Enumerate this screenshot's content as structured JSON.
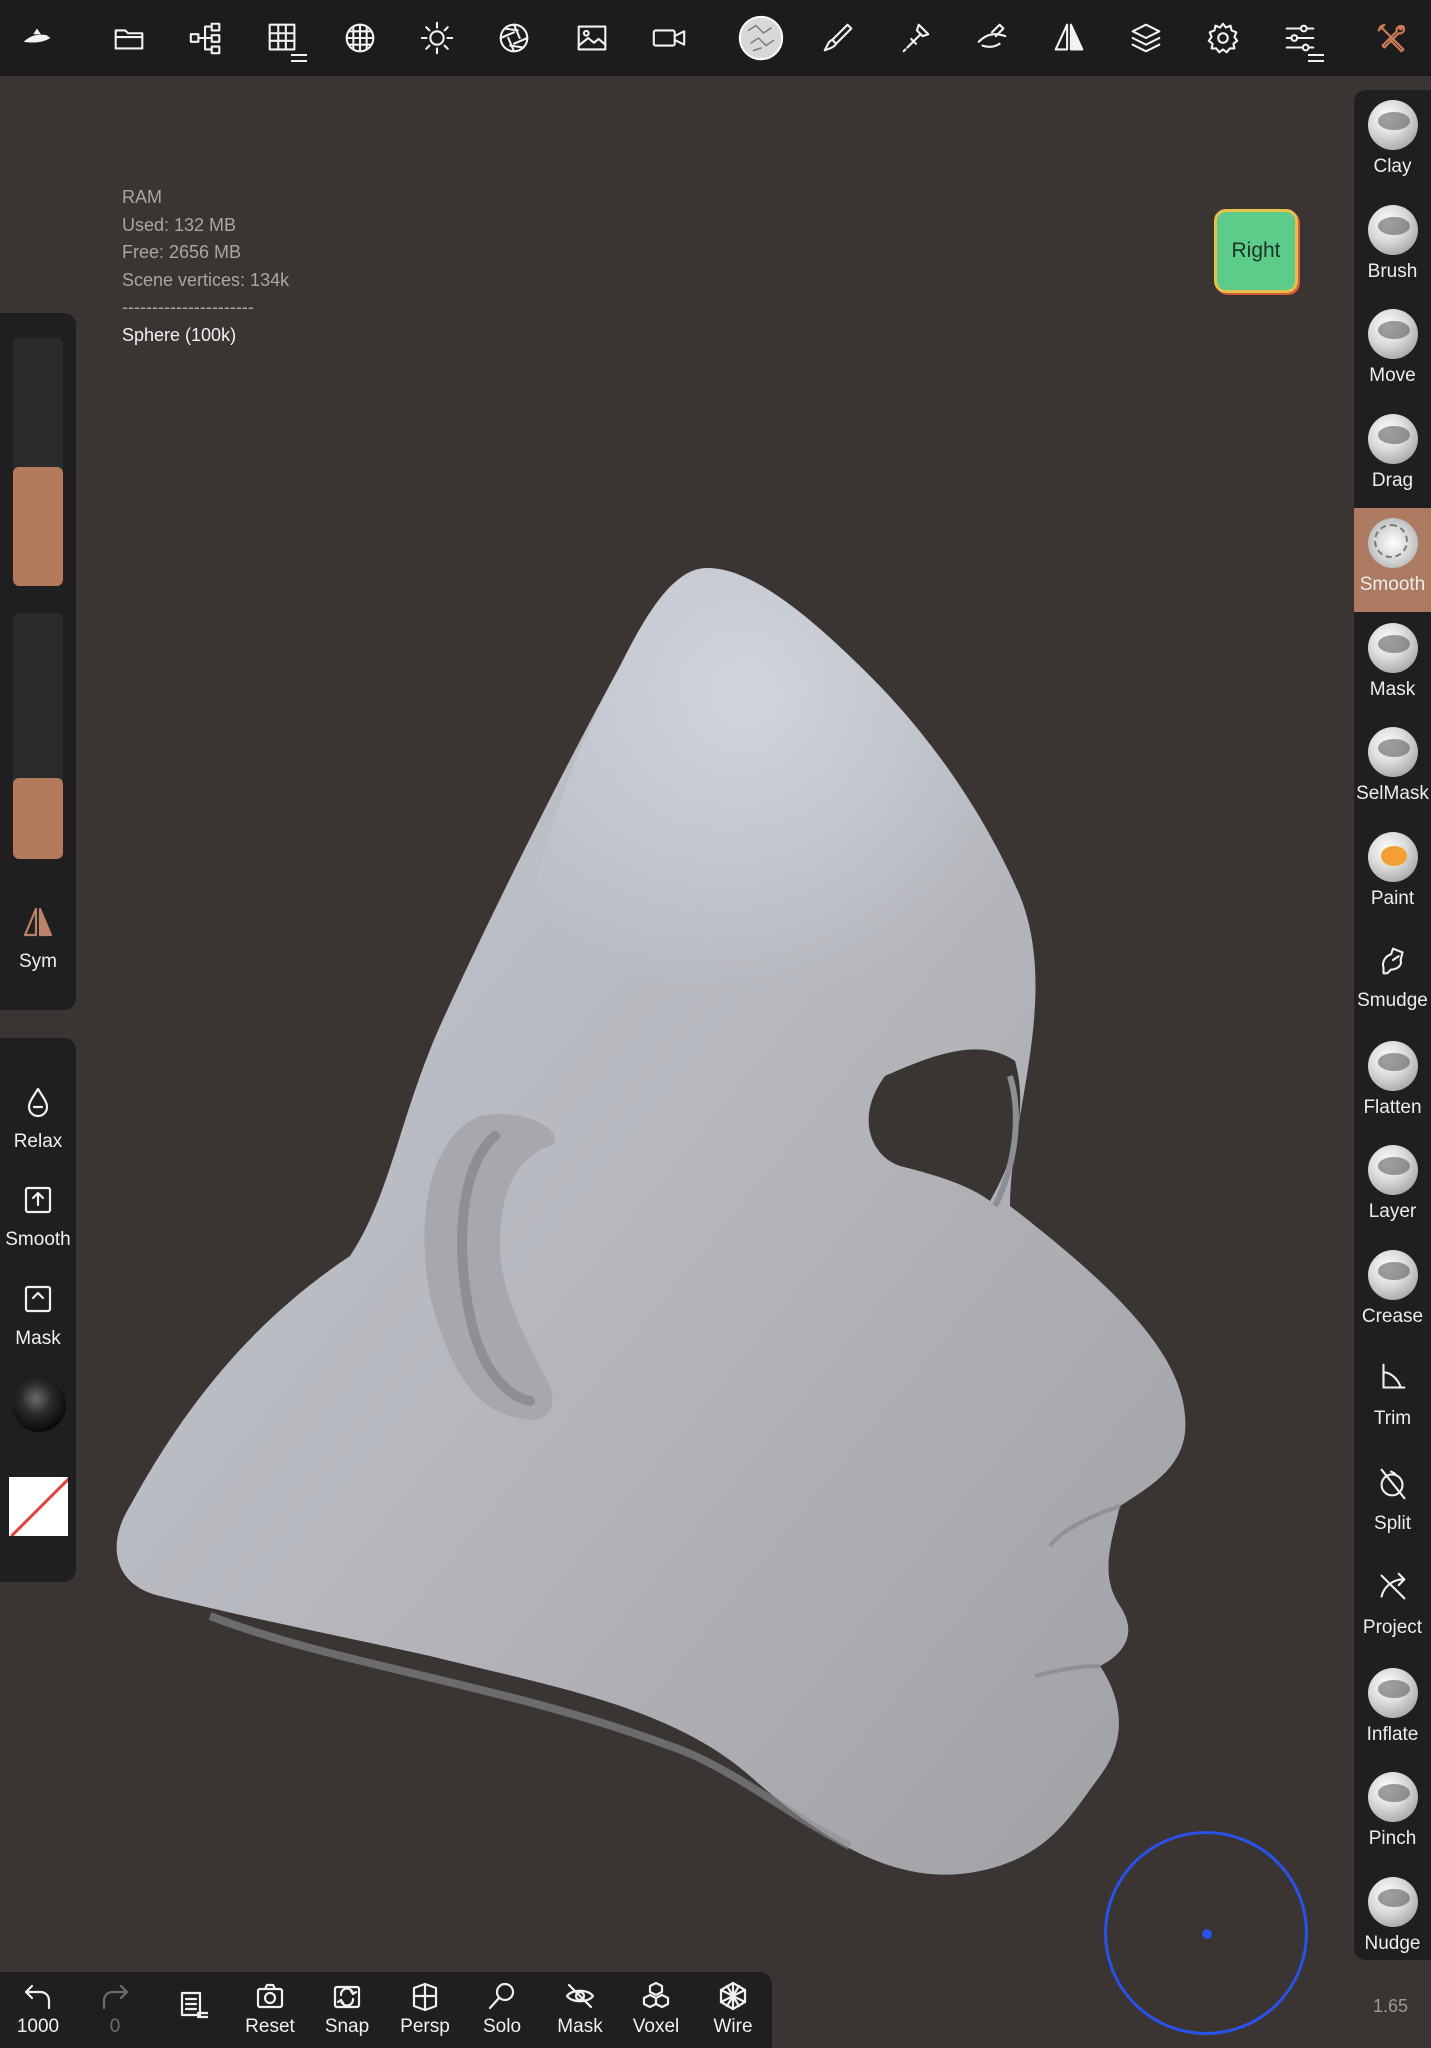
{
  "colors": {
    "accent": "#ab7a60",
    "slider_fill": "#b37a5c",
    "view_cube": "#5dcb8a",
    "joystick": "#2a52e8",
    "paint_stroke": "#f2a033"
  },
  "top_bar": {
    "icons": [
      "app-logo-icon",
      "folder-icon",
      "scene-tree-icon",
      "topology-grid-icon",
      "multires-icon",
      "light-icon",
      "aperture-icon",
      "image-icon",
      "camera-icon",
      "brush-alpha-icon",
      "paint-brush-icon",
      "stroke-icon",
      "curve-icon",
      "symmetry-icon",
      "layers-icon",
      "settings-icon",
      "sliders-icon",
      "tools-icon"
    ]
  },
  "stats": {
    "ram_label": "RAM",
    "used": "Used: 132 MB",
    "free": "Free: 2656 MB",
    "scene_vertices": "Scene vertices: 134k",
    "separator": "----------------------",
    "mesh_name": "Sphere (100k)"
  },
  "view_cube": {
    "label": "Right"
  },
  "left_panel": {
    "radius_slider": {
      "value": 0.48
    },
    "intensity_slider": {
      "value": 0.33
    },
    "sym_label": "Sym",
    "relax_label": "Relax",
    "smooth_label": "Smooth",
    "mask_label": "Mask"
  },
  "tools": [
    {
      "label": "Clay",
      "kind": "ball",
      "active": false
    },
    {
      "label": "Brush",
      "kind": "ball",
      "active": false
    },
    {
      "label": "Move",
      "kind": "ball",
      "active": false
    },
    {
      "label": "Drag",
      "kind": "ball",
      "active": false
    },
    {
      "label": "Smooth",
      "kind": "smooth",
      "active": true
    },
    {
      "label": "Mask",
      "kind": "ball",
      "active": false
    },
    {
      "label": "SelMask",
      "kind": "ball",
      "active": false
    },
    {
      "label": "Paint",
      "kind": "paint",
      "active": false
    },
    {
      "label": "Smudge",
      "kind": "icon",
      "icon": "smudge-icon",
      "active": false
    },
    {
      "label": "Flatten",
      "kind": "ball",
      "active": false
    },
    {
      "label": "Layer",
      "kind": "ball",
      "active": false
    },
    {
      "label": "Crease",
      "kind": "ball",
      "active": false
    },
    {
      "label": "Trim",
      "kind": "icon",
      "icon": "trim-icon",
      "active": false
    },
    {
      "label": "Split",
      "kind": "icon",
      "icon": "split-icon",
      "active": false
    },
    {
      "label": "Project",
      "kind": "icon",
      "icon": "project-icon",
      "active": false
    },
    {
      "label": "Inflate",
      "kind": "ball",
      "active": false
    },
    {
      "label": "Pinch",
      "kind": "ball",
      "active": false
    },
    {
      "label": "Nudge",
      "kind": "ball",
      "active": false
    }
  ],
  "bottom_bar": {
    "undo_count": "1000",
    "redo_count": "0",
    "reset": "Reset",
    "snap": "Snap",
    "persp": "Persp",
    "solo": "Solo",
    "mask": "Mask",
    "voxel": "Voxel",
    "wire": "Wire"
  },
  "zoom": "1.65"
}
